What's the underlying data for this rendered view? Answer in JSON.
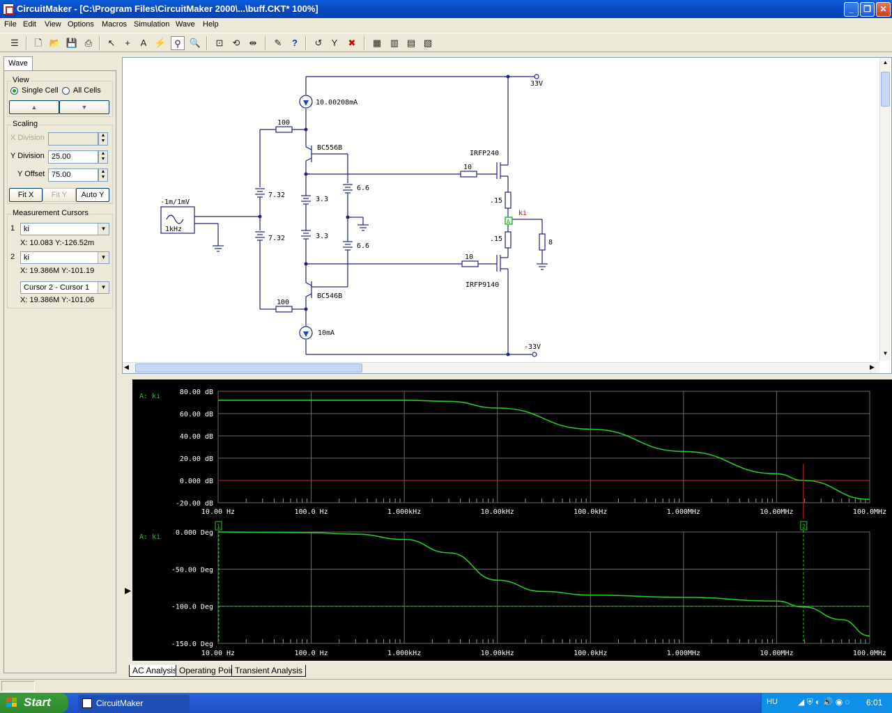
{
  "window": {
    "title": "CircuitMaker - [C:\\Program Files\\CircuitMaker 2000\\...\\buff.CKT* 100%]"
  },
  "menu": [
    "File",
    "Edit",
    "View",
    "Options",
    "Macros",
    "Simulation",
    "Wave",
    "Help"
  ],
  "panel": {
    "tab": "Wave",
    "view": {
      "label": "View",
      "single_cell": "Single Cell",
      "all_cells": "All Cells",
      "up": "▲",
      "down": "▼"
    },
    "scaling": {
      "label": "Scaling",
      "x_division_label": "X Division",
      "x_division_value": "",
      "y_division_label": "Y Division",
      "y_division_value": "25.00",
      "y_offset_label": "Y Offset",
      "y_offset_value": "75.00",
      "fit_x": "Fit X",
      "fit_y": "Fit Y",
      "auto_y": "Auto Y"
    },
    "cursors": {
      "label": "Measurement Cursors",
      "c1": {
        "num": "1",
        "signal": "ki",
        "readout": "X: 10.083    Y:-126.52m"
      },
      "c2": {
        "num": "2",
        "signal": "ki",
        "readout": "X: 19.386M  Y:-101.19"
      },
      "diff": {
        "signal": "Cursor 2 - Cursor 1",
        "readout": "X: 19.386M  Y:-101.06"
      }
    }
  },
  "schematic": {
    "labels": {
      "vplus": "33V",
      "vminus": "-33V",
      "i_top": "10.00208mA",
      "i_bot": "10mA",
      "r100a": "100",
      "r100b": "100",
      "q1": "BC556B",
      "q2": "BC546B",
      "m1": "IRFP240",
      "m2": "IRFP9140",
      "r10a": "10",
      "r10b": "10",
      "b732a": "7.32",
      "b732b": "7.32",
      "b33a": "3.3",
      "b33b": "3.3",
      "b66a": "6.6",
      "b66b": "6.6",
      "rs1": ".15",
      "rs2": ".15",
      "rl": "8",
      "probe": "ki",
      "probe_tag": "A",
      "src_top": "-1m/1mV",
      "src_bot": "1kHz"
    }
  },
  "waves": {
    "mag_label": "A: ki",
    "phase_label": "A: ki",
    "mag_yticks": [
      "80.00 dB",
      "60.00 dB",
      "40.00 dB",
      "20.00 dB",
      "0.000 dB",
      "-20.00 dB"
    ],
    "phase_yticks": [
      "0.000 Deg",
      "-50.00 Deg",
      "-100.0 Deg",
      "-150.0 Deg"
    ],
    "xticks": [
      "10.00 Hz",
      "100.0 Hz",
      "1.000kHz",
      "10.00kHz",
      "100.0kHz",
      "1.000MHz",
      "10.00MHz",
      "100.0MHz"
    ],
    "cursor1_tag": "1",
    "cursor2_tag": "2",
    "trace_color": "#22cc22",
    "cursor_color": "#e02020"
  },
  "chart_data": [
    {
      "type": "line",
      "title": "A: ki",
      "xscale": "log",
      "xlim": [
        10,
        100000000
      ],
      "ylim": [
        -20,
        80
      ],
      "ylabel": "dB",
      "series": [
        {
          "name": "A: ki",
          "x": [
            10,
            100,
            1000,
            3000,
            10000,
            100000,
            1000000,
            10000000,
            19386000,
            100000000
          ],
          "y": [
            72,
            72,
            72,
            71,
            65,
            46,
            26,
            6,
            0,
            -17
          ]
        }
      ]
    },
    {
      "type": "line",
      "title": "A: ki",
      "xscale": "log",
      "xlim": [
        10,
        100000000
      ],
      "ylim": [
        -150,
        0
      ],
      "ylabel": "Deg",
      "series": [
        {
          "name": "A: ki",
          "x": [
            10,
            100,
            300,
            1000,
            3000,
            10000,
            30000,
            100000,
            1000000,
            10000000,
            19386000,
            50000000,
            100000000
          ],
          "y": [
            -0.1,
            -1,
            -3,
            -10,
            -28,
            -65,
            -80,
            -85,
            -88,
            -93,
            -101,
            -118,
            -140
          ]
        }
      ]
    }
  ],
  "bottom_tabs": [
    "AC Analysis",
    "Operating Point",
    "Transient Analysis"
  ],
  "taskbar": {
    "start": "Start",
    "app": "CircuitMaker",
    "lang": "HU",
    "time": "6:01"
  }
}
